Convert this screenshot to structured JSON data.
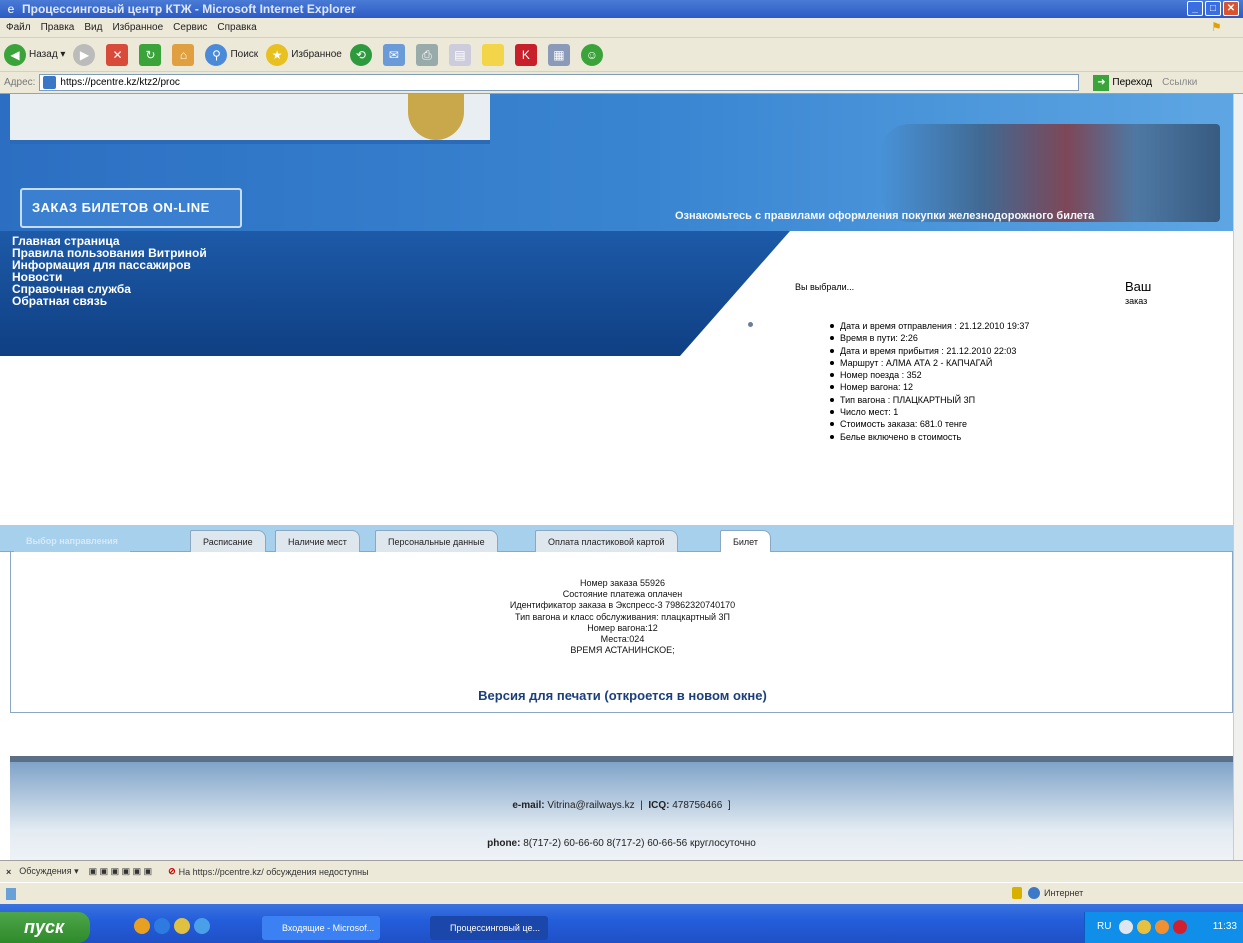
{
  "window": {
    "title": "Процессинговый центр КТЖ - Microsoft Internet Explorer",
    "minimize": "_",
    "maximize": "□",
    "close": "✕"
  },
  "menu": [
    "Файл",
    "Правка",
    "Вид",
    "Избранное",
    "Сервис",
    "Справка"
  ],
  "toolbar": {
    "back_label": "Назад",
    "search_label": "Поиск",
    "favorites_label": "Избранное"
  },
  "address": {
    "label": "Адрес:",
    "url": "https://pcentre.kz/ktz2/proc",
    "go_label": "Переход",
    "links_label": "Ссылки"
  },
  "site": {
    "order_button": "ЗАКАЗ БИЛЕТОВ ON-LINE",
    "rules_link": "Ознакомьтесь с правилами оформления покупки железнодорожного билета",
    "nav": [
      "Главная страница",
      "Правила пользования Витриной",
      "Информация для пассажиров",
      "Новости",
      "Справочная служба",
      "Обратная связь"
    ],
    "chose_label": "Вы выбрали...",
    "order_label": "Ваш",
    "order_sub": "заказ",
    "selections": [
      "Дата и время отправления : 21.12.2010 19:37",
      "Время в пути: 2:26",
      "Дата и время прибытия : 21.12.2010 22:03",
      "Маршрут : АЛМА АТА 2 - КАПЧАГАЙ",
      "Номер поезда : 352",
      "Номер вагона: 12",
      "Тип вагона : ПЛАЦКАРТНЫЙ 3П",
      "Число мест: 1",
      "Стоимость заказа: 681.0 тенге",
      "Белье включено в стоимость"
    ],
    "tabs": [
      "Выбор направления",
      "Расписание",
      "Наличие мест",
      "Персональные данные",
      "Оплата пластиковой картой",
      "Билет"
    ],
    "ticket": [
      "Номер заказа 55926",
      "Состояние платежа оплачен",
      "Идентификатор заказа в Экспресс-3 79862320740170",
      "Тип вагона и класс обслуживания: плацкартный 3П",
      "Номер вагона:12",
      "Места:024",
      "ВРЕМЯ АСТАНИНСКОЕ;"
    ],
    "print_link": "Версия для печати (откроется в новом окне)",
    "email_label": "e-mail:",
    "email_value": "Vitrina@railways.kz",
    "icq_label": "ICQ:",
    "icq_value": "478756466",
    "sep": "|",
    "sep2": "]",
    "phone_label": "phone:",
    "phone_value": "8(717-2) 60-66-60 8(717-2) 60-66-56 круглосуточно"
  },
  "infobar": {
    "close": "×",
    "discuss": "Обсуждения ▾",
    "message": "На https://pcentre.kz/ обсуждения недоступны"
  },
  "status": {
    "zone": "Интернет"
  },
  "taskbar": {
    "start": "пуск",
    "task1": "Входящие - Microsof...",
    "task2": "Процессинговый це...",
    "lang": "RU",
    "clock": "11:33"
  },
  "colors": {
    "header_blue": "#3a86d2",
    "nav_blue": "#1d5aa8",
    "panel_light": "#a6d0ec",
    "link_dark": "#1c3f7c"
  }
}
